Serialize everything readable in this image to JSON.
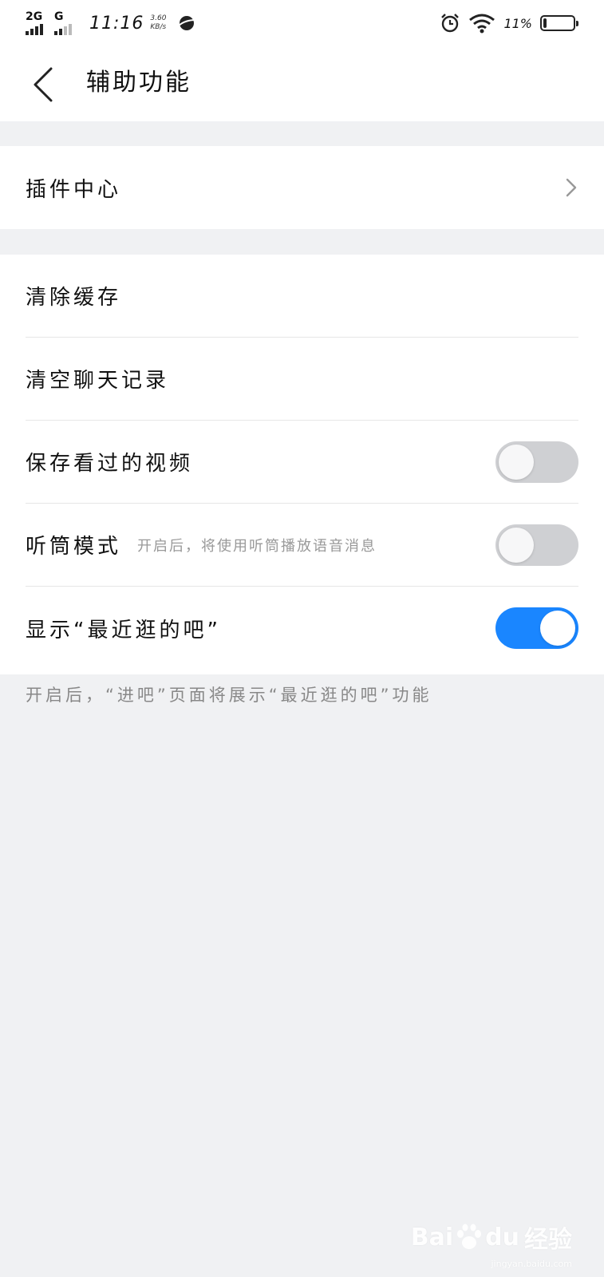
{
  "status_bar": {
    "network_1": "2G",
    "network_2": "G",
    "time": "11:16",
    "speed_value": "3.60",
    "speed_unit": "KB/s",
    "battery_percent": "11%",
    "battery_level": 0.11
  },
  "header": {
    "back_icon": "chevron-left-icon",
    "title": "辅助功能"
  },
  "section_1": {
    "items": [
      {
        "label": "插件中心",
        "icon": "chevron-right-icon"
      }
    ]
  },
  "section_2": {
    "items": [
      {
        "label": "清除缓存"
      },
      {
        "label": "清空聊天记录"
      },
      {
        "label": "保存看过的视频",
        "toggle": false
      },
      {
        "label": "听筒模式",
        "hint": "开启后，将使用听筒播放语音消息",
        "toggle": false
      },
      {
        "label": "显示“最近逛的吧”",
        "toggle": true
      }
    ]
  },
  "footnote": "开启后，“进吧”页面将展示“最近逛的吧”功能",
  "watermark": {
    "text_left": "Bai",
    "text_right": "du",
    "text_cn": "经验",
    "sub": "jingyan.baidu.com"
  },
  "colors": {
    "accent": "#1a86ff",
    "background": "#f0f1f3",
    "toggle_off": "#cfd0d3"
  }
}
